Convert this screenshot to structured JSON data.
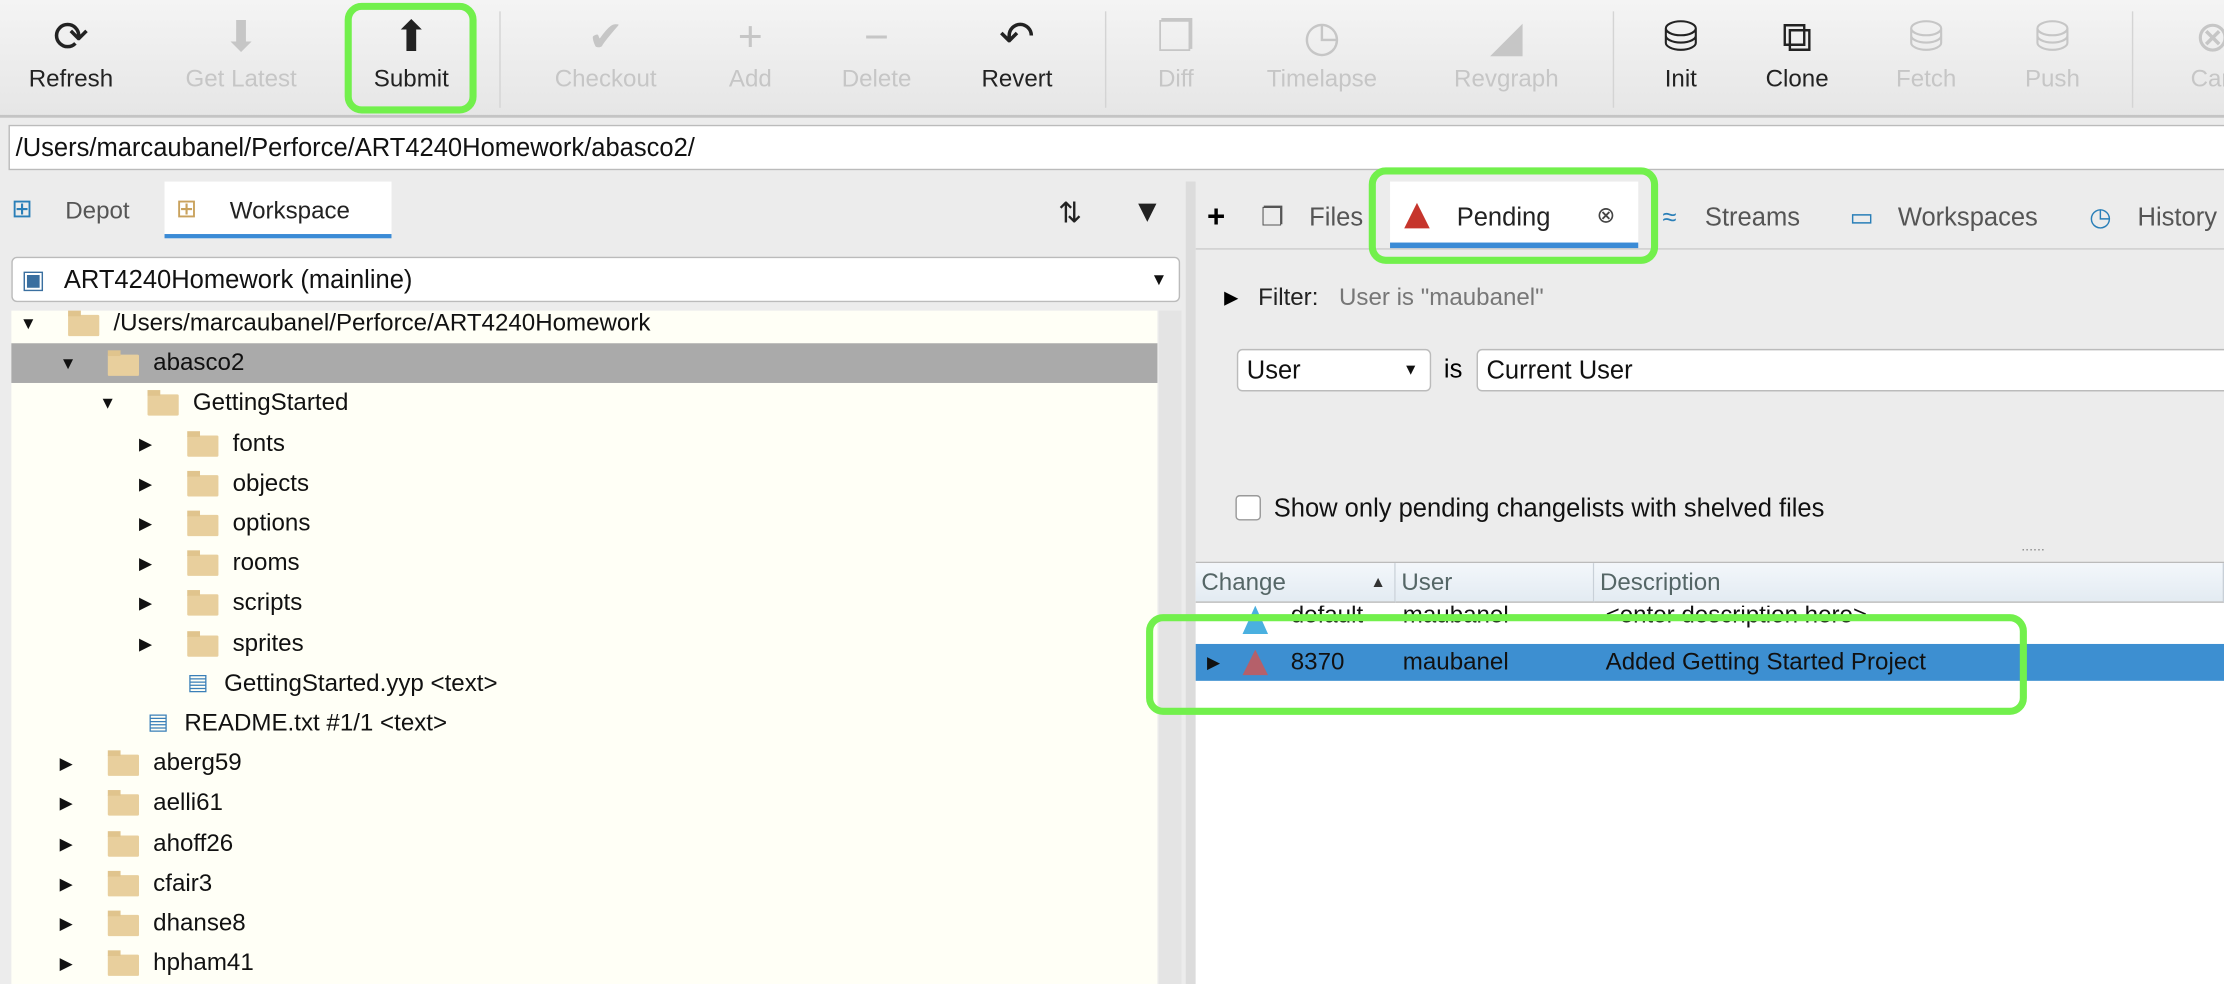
{
  "toolbar": {
    "buttons": [
      {
        "label": "Refresh",
        "icon": "refresh-icon",
        "enabled": true
      },
      {
        "label": "Get Latest",
        "icon": "get-latest-icon",
        "enabled": false
      },
      {
        "label": "Submit",
        "icon": "submit-icon",
        "enabled": true,
        "highlighted": true
      },
      {
        "label": "Checkout",
        "icon": "checkmark-icon",
        "enabled": false
      },
      {
        "label": "Add",
        "icon": "plus-icon",
        "enabled": false
      },
      {
        "label": "Delete",
        "icon": "minus-icon",
        "enabled": false
      },
      {
        "label": "Revert",
        "icon": "revert-arrow-icon",
        "enabled": true
      },
      {
        "label": "Diff",
        "icon": "diff-icon",
        "enabled": false
      },
      {
        "label": "Timelapse",
        "icon": "clock-icon",
        "enabled": false
      },
      {
        "label": "Revgraph",
        "icon": "revgraph-icon",
        "enabled": false
      },
      {
        "label": "Init",
        "icon": "init-icon",
        "enabled": true
      },
      {
        "label": "Clone",
        "icon": "clone-icon",
        "enabled": true
      },
      {
        "label": "Fetch",
        "icon": "fetch-icon",
        "enabled": false
      },
      {
        "label": "Push",
        "icon": "push-icon",
        "enabled": false
      },
      {
        "label": "Can",
        "icon": "cancel-icon",
        "enabled": false
      }
    ]
  },
  "path": "/Users/marcaubanel/Perforce/ART4240Homework/abasco2/",
  "left": {
    "tabs": [
      "Depot",
      "Workspace"
    ],
    "workspace": "ART4240Homework (mainline)",
    "tree": [
      {
        "label": "/Users/marcaubanel/Perforce/ART4240Homework",
        "depth": 0,
        "expanded": true
      },
      {
        "label": "abasco2",
        "depth": 1,
        "expanded": true,
        "selected": true
      },
      {
        "label": "GettingStarted",
        "depth": 2,
        "expanded": true
      },
      {
        "label": "fonts",
        "depth": 3
      },
      {
        "label": "objects",
        "depth": 3
      },
      {
        "label": "options",
        "depth": 3
      },
      {
        "label": "rooms",
        "depth": 3
      },
      {
        "label": "scripts",
        "depth": 3
      },
      {
        "label": "sprites",
        "depth": 3
      },
      {
        "label": "GettingStarted.yyp  <text>",
        "depth": 3,
        "file": true
      },
      {
        "label": "README.txt #1/1 <text>",
        "depth": 2,
        "file": true
      },
      {
        "label": "aberg59",
        "depth": 1
      },
      {
        "label": "aelli61",
        "depth": 1
      },
      {
        "label": "ahoff26",
        "depth": 1
      },
      {
        "label": "cfair3",
        "depth": 1
      },
      {
        "label": "dhanse8",
        "depth": 1
      },
      {
        "label": "hpham41",
        "depth": 1
      }
    ]
  },
  "right": {
    "add": "+",
    "tabs": [
      "Files",
      "Pending",
      "Streams",
      "Workspaces",
      "History"
    ],
    "filter_label": "Filter:",
    "filter_value": "User is \"maubanel\"",
    "field": "User",
    "op": "is",
    "value": "Current User",
    "shelved_checkbox": "Show only pending changelists with shelved files",
    "columns": [
      "Change",
      "User",
      "Description"
    ],
    "rows": [
      {
        "change": "default",
        "user": "maubanel",
        "description": "<enter description here>",
        "color": "#4ab0e0"
      },
      {
        "change": "8370",
        "user": "maubanel",
        "description": "Added Getting Started Project",
        "color": "#b5606a",
        "selected": true
      }
    ]
  },
  "colors": {
    "highlight": "#72f04c",
    "selection": "#3d8fd1",
    "accent": "#3b8bd6"
  }
}
